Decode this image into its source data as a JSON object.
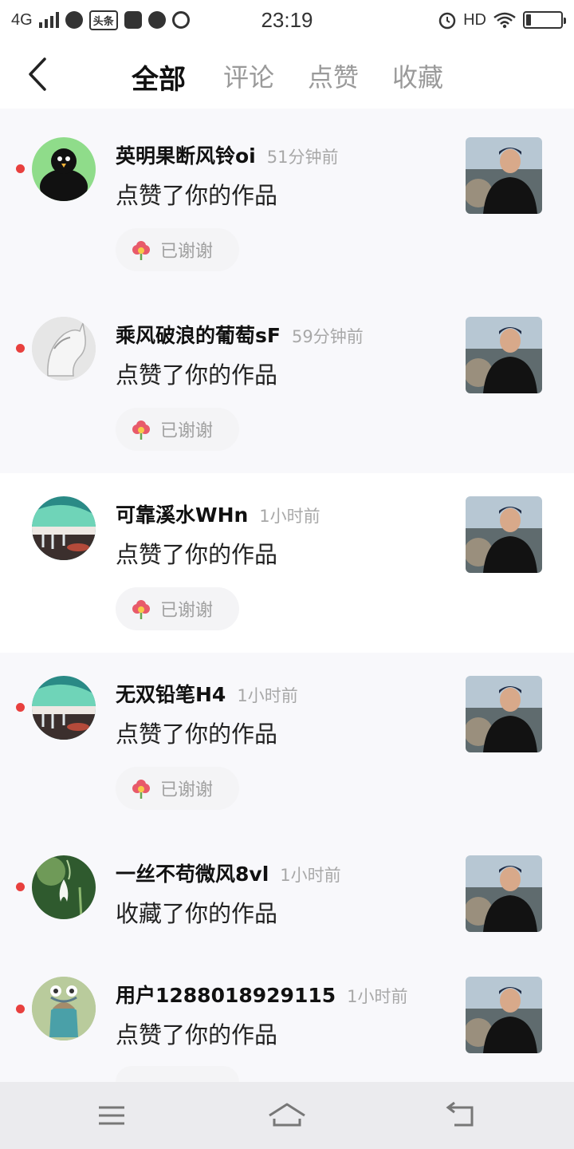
{
  "status_bar": {
    "network": "4G",
    "app_label": "头条",
    "time": "23:19",
    "hd": "HD"
  },
  "tabs": [
    {
      "label": "全部",
      "active": true
    },
    {
      "label": "评论",
      "active": false
    },
    {
      "label": "点赞",
      "active": false
    },
    {
      "label": "收藏",
      "active": false
    }
  ],
  "notifications": [
    {
      "username": "英明果断风铃oi",
      "time": "51分钟前",
      "action": "点赞了你的作品",
      "button": "已谢谢",
      "unread": true
    },
    {
      "username": "乘风破浪的葡萄sF",
      "time": "59分钟前",
      "action": "点赞了你的作品",
      "button": "已谢谢",
      "unread": true
    },
    {
      "username": "可靠溪水WHn",
      "time": "1小时前",
      "action": "点赞了你的作品",
      "button": "已谢谢",
      "unread": false
    },
    {
      "username": "无双铅笔H4",
      "time": "1小时前",
      "action": "点赞了你的作品",
      "button": "已谢谢",
      "unread": true
    },
    {
      "username": "一丝不苟微风8vl",
      "time": "1小时前",
      "action": "收藏了你的作品",
      "button": "",
      "unread": true
    },
    {
      "username": "用户1288018929115",
      "time": "1小时前",
      "action": "点赞了你的作品",
      "button": "",
      "unread": true
    }
  ],
  "colors": {
    "accent_dot": "#e8403e",
    "muted_text": "#a8a8a8",
    "shaded_row": "#f8f8fb"
  },
  "icons": {
    "back": "chevron-left-icon",
    "thanks": "flower-icon",
    "nav": [
      "menu-icon",
      "home-icon",
      "return-icon"
    ]
  }
}
